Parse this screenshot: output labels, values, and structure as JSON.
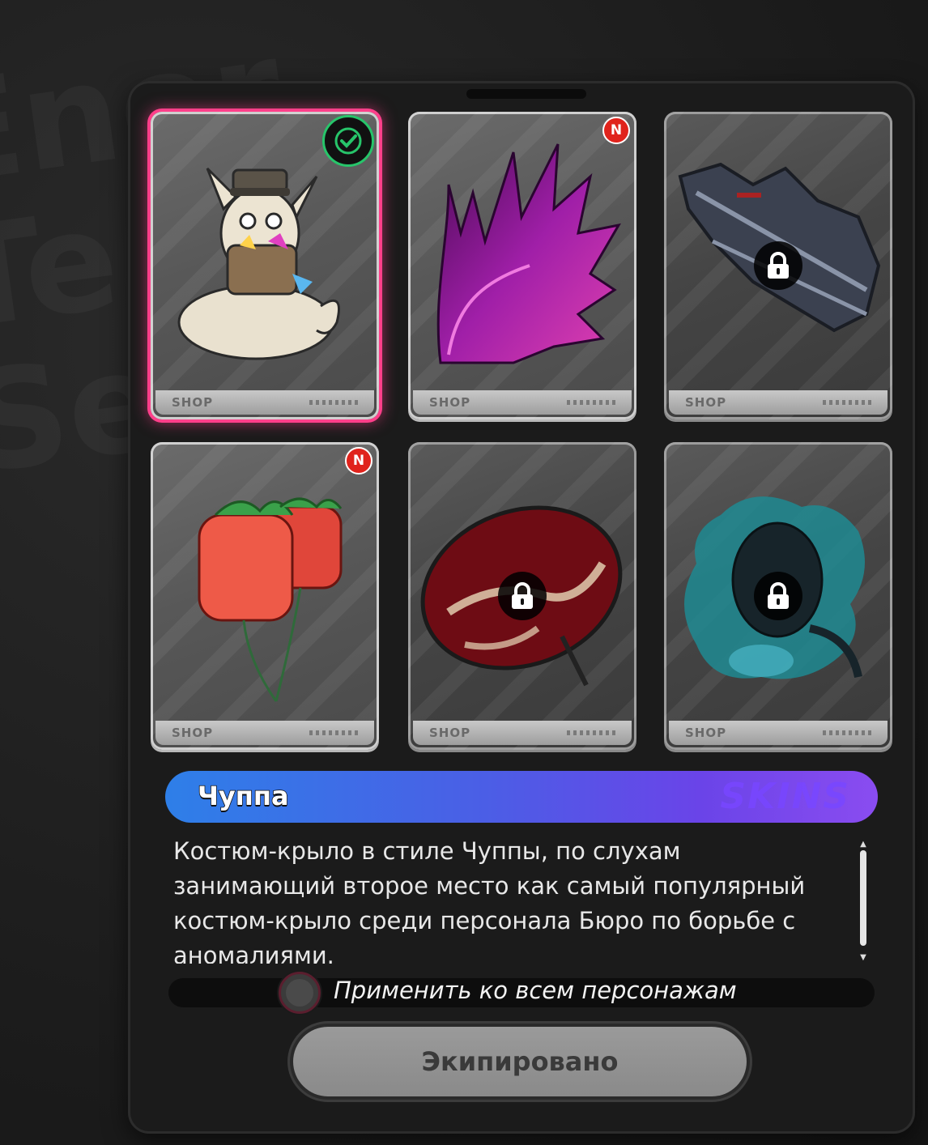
{
  "skins": [
    {
      "id": "chuppa",
      "status": "equipped",
      "badge": "check",
      "locked": false,
      "footer": "SHOP",
      "icon": "chuppa-creature-icon"
    },
    {
      "id": "purple-flame-wing",
      "status": "new",
      "badge": "N",
      "locked": false,
      "footer": "SHOP",
      "icon": "purple-flame-wing-icon"
    },
    {
      "id": "bat-wing",
      "status": "locked",
      "badge": "",
      "locked": true,
      "footer": "SHOP",
      "icon": "bat-wing-icon"
    },
    {
      "id": "strawberry-balloons",
      "status": "new",
      "badge": "N",
      "locked": false,
      "footer": "SHOP",
      "icon": "strawberry-balloon-icon"
    },
    {
      "id": "red-umbrella",
      "status": "locked",
      "badge": "",
      "locked": true,
      "footer": "SHOP",
      "icon": "red-umbrella-icon"
    },
    {
      "id": "ghost-creature",
      "status": "locked",
      "badge": "",
      "locked": true,
      "footer": "SHOP",
      "icon": "ghost-creature-icon"
    }
  ],
  "selected": {
    "name": "Чуппа",
    "tag": "SKINS",
    "description": "Костюм-крыло в стиле Чуппы, по слухам занимающий второе место как самый популярный костюм-крыло среди персонала Бюро по борьбе с аномалиями."
  },
  "apply_all_label": "Применить ко всем персонажам",
  "equip_button_label": "Экипировано",
  "colors": {
    "selected_border": "#ff3f8a",
    "new_badge": "#e0231c",
    "check": "#27c56a",
    "accent_start": "#2e7fe8",
    "accent_end": "#8a4cf0"
  }
}
